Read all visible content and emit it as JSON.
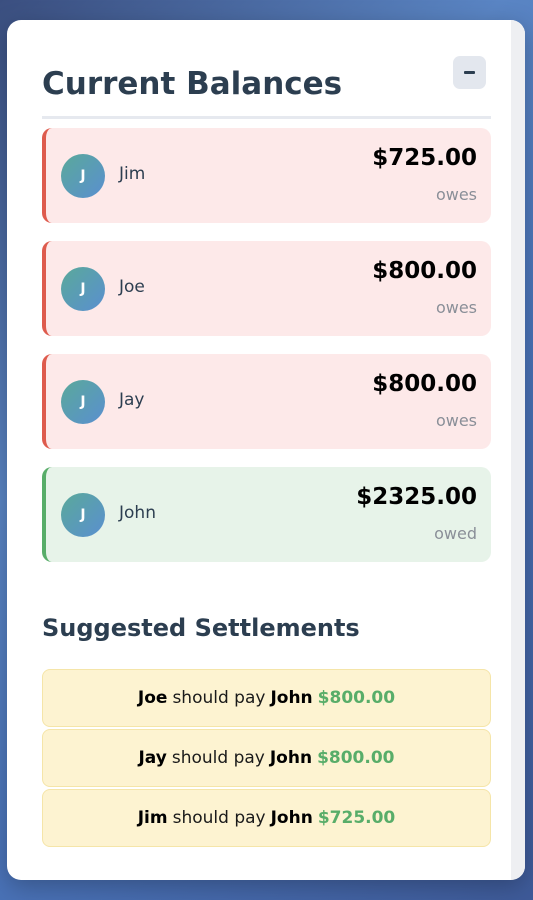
{
  "header": {
    "title": "Current Balances",
    "collapse_button": "minus-icon"
  },
  "balances": [
    {
      "initial": "J",
      "name": "Jim",
      "amount": "$725.00",
      "status": "owes",
      "type": "debt"
    },
    {
      "initial": "J",
      "name": "Joe",
      "amount": "$800.00",
      "status": "owes",
      "type": "debt"
    },
    {
      "initial": "J",
      "name": "Jay",
      "amount": "$800.00",
      "status": "owes",
      "type": "debt"
    },
    {
      "initial": "J",
      "name": "John",
      "amount": "$2325.00",
      "status": "owed",
      "type": "credit"
    }
  ],
  "settlements": {
    "title": "Suggested Settlements",
    "items": [
      {
        "from": "Joe",
        "phrase": "should pay",
        "to": "John",
        "amount": "$800.00"
      },
      {
        "from": "Jay",
        "phrase": "should pay",
        "to": "John",
        "amount": "$800.00"
      },
      {
        "from": "Jim",
        "phrase": "should pay",
        "to": "John",
        "amount": "$725.00"
      }
    ]
  },
  "colors": {
    "debt_accent": "#de5b4d",
    "credit_accent": "#58ad69",
    "amount_green": "#58ad69",
    "title_color": "#2c3e50"
  }
}
